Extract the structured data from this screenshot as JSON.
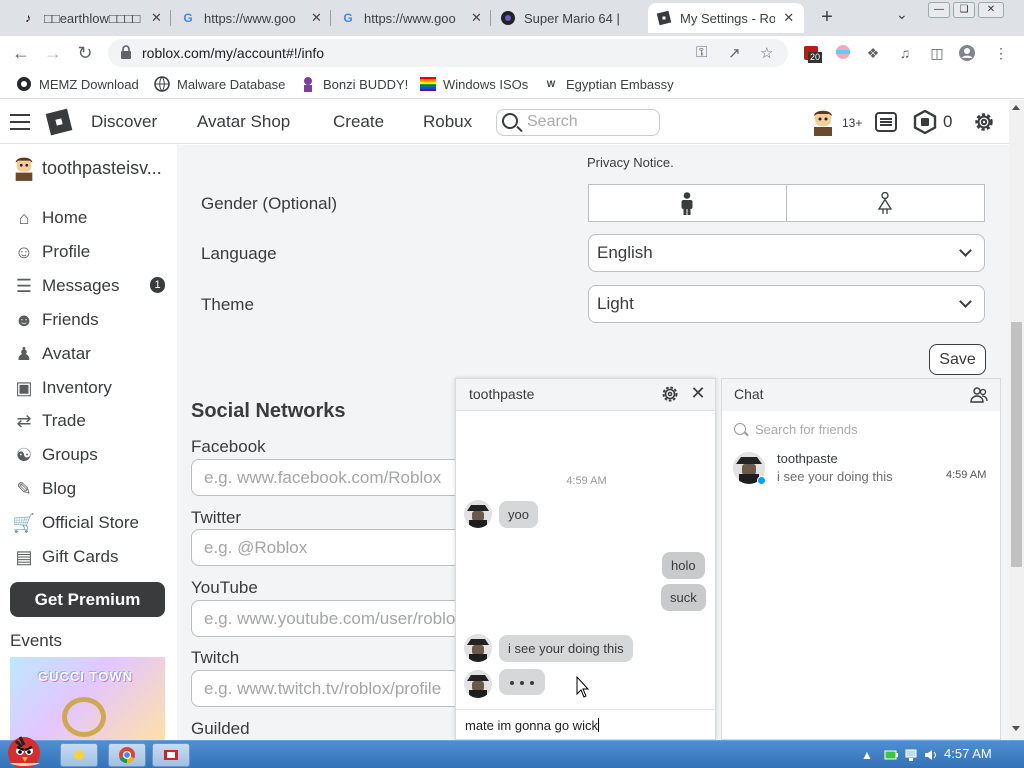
{
  "browser": {
    "tabs": [
      {
        "title": "□□earthlow□□□□",
        "favicon": "tiktok-icon",
        "active": false
      },
      {
        "title": "https://www.goo",
        "favicon": "google-icon",
        "active": false
      },
      {
        "title": "https://www.goo",
        "favicon": "google-icon",
        "active": false
      },
      {
        "title": "Super Mario 64 |",
        "favicon": "mario-icon",
        "active": false
      },
      {
        "title": "My Settings - Ro",
        "favicon": "roblox-icon",
        "active": true
      }
    ],
    "url": "roblox.com/my/account#!/info",
    "extension_badge": "20",
    "bookmarks": [
      {
        "label": "MEMZ Download",
        "icon": "github-icon"
      },
      {
        "label": "Malware Database",
        "icon": "globe-icon"
      },
      {
        "label": "Bonzi BUDDY!",
        "icon": "bonzi-icon"
      },
      {
        "label": "Windows ISOs",
        "icon": "rainbow-flag-icon"
      },
      {
        "label": "Egyptian Embassy",
        "icon": "wix-icon"
      }
    ]
  },
  "header": {
    "nav": [
      "Discover",
      "Avatar Shop",
      "Create",
      "Robux"
    ],
    "search_placeholder": "Search",
    "age": "13+",
    "robux": "0"
  },
  "sidebar": {
    "username": "toothpasteisv...",
    "items": [
      {
        "label": "Home",
        "icon": "home-icon"
      },
      {
        "label": "Profile",
        "icon": "profile-icon"
      },
      {
        "label": "Messages",
        "icon": "messages-icon"
      },
      {
        "label": "Friends",
        "icon": "friends-icon"
      },
      {
        "label": "Avatar",
        "icon": "avatar-icon"
      },
      {
        "label": "Inventory",
        "icon": "inventory-icon"
      },
      {
        "label": "Trade",
        "icon": "trade-icon"
      },
      {
        "label": "Groups",
        "icon": "groups-icon"
      },
      {
        "label": "Blog",
        "icon": "blog-icon"
      },
      {
        "label": "Official Store",
        "icon": "cart-icon"
      },
      {
        "label": "Gift Cards",
        "icon": "gift-icon"
      }
    ],
    "messages_badge": "1",
    "premium_button": "Get Premium",
    "events_label": "Events",
    "event_banner_text": "GUCCI TOWN"
  },
  "settings": {
    "privacy_notice": "Privacy Notice.",
    "gender_label": "Gender (Optional)",
    "language_label": "Language",
    "language_value": "English",
    "theme_label": "Theme",
    "theme_value": "Light",
    "save_button": "Save",
    "social_title": "Social Networks",
    "social": [
      {
        "label": "Facebook",
        "placeholder": "e.g. www.facebook.com/Roblox"
      },
      {
        "label": "Twitter",
        "placeholder": "e.g. @Roblox"
      },
      {
        "label": "YouTube",
        "placeholder": "e.g. www.youtube.com/user/roblox"
      },
      {
        "label": "Twitch",
        "placeholder": "e.g. www.twitch.tv/roblox/profile"
      },
      {
        "label": "Guilded",
        "placeholder": ""
      }
    ]
  },
  "conversation": {
    "title": "toothpaste",
    "time": "4:59 AM",
    "messages": [
      {
        "text": "yoo",
        "from": "them"
      },
      {
        "text": "holo",
        "from": "me"
      },
      {
        "text": "suck",
        "from": "me"
      },
      {
        "text": "i see your doing this",
        "from": "them"
      }
    ],
    "typing": "• • •",
    "input_value": "mate im gonna go wick"
  },
  "chat": {
    "title": "Chat",
    "search_placeholder": "Search for friends",
    "conversations": [
      {
        "name": "toothpaste",
        "last_message": "i see your doing this",
        "time": "4:59 AM"
      }
    ]
  },
  "taskbar": {
    "clock": "4:57 AM"
  },
  "colors": {
    "roblox_text": "#393b3d",
    "page_background": "#f2f4f5",
    "online_dot": "#00a2ff",
    "taskbar": "#3571b8"
  }
}
